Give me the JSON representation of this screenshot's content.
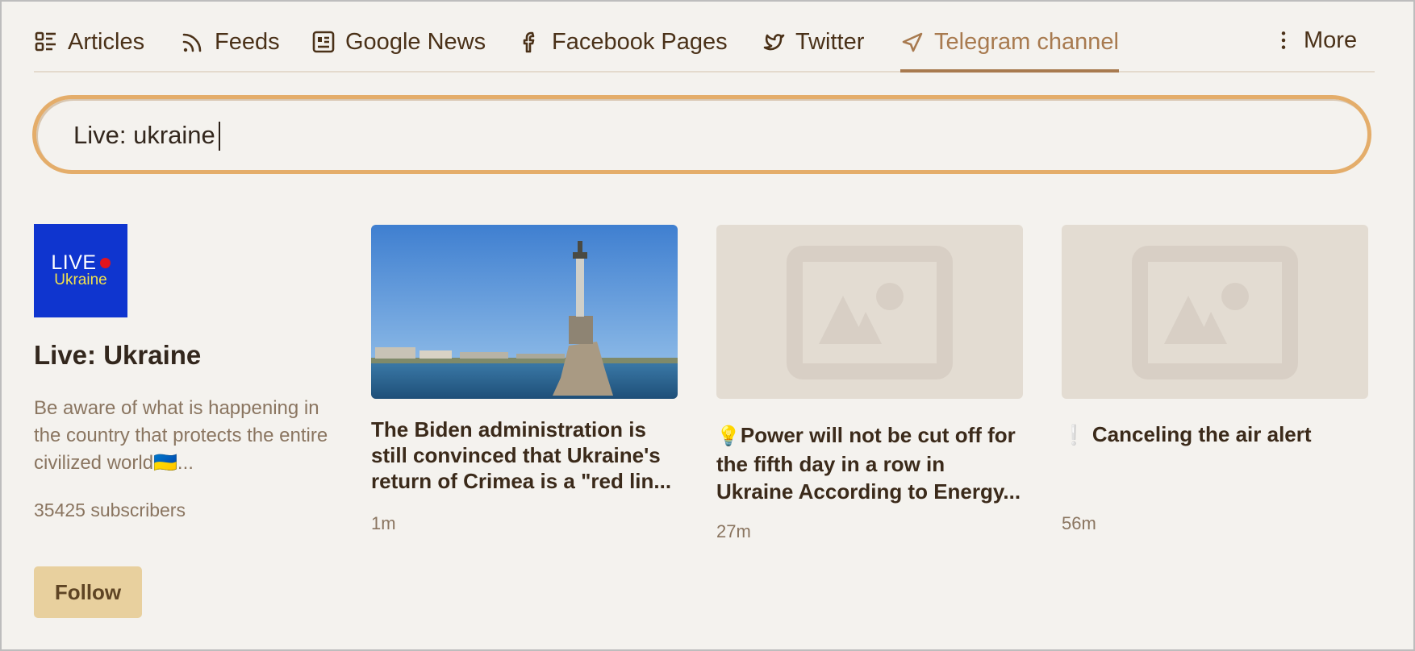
{
  "nav": {
    "tabs": [
      {
        "label": "Articles",
        "icon": "articles-list-icon",
        "active": false
      },
      {
        "label": "Feeds",
        "icon": "rss-icon",
        "active": false
      },
      {
        "label": "Google News",
        "icon": "newspaper-icon",
        "active": false
      },
      {
        "label": "Facebook Pages",
        "icon": "facebook-icon",
        "active": false
      },
      {
        "label": "Twitter",
        "icon": "twitter-icon",
        "active": false
      },
      {
        "label": "Telegram channel",
        "icon": "telegram-icon",
        "active": true
      }
    ],
    "more_label": "More",
    "accent_color": "#a87a4f"
  },
  "search": {
    "value": "Live: ukraine"
  },
  "channel": {
    "logo_line1": "LIVE",
    "logo_line2": "Ukraine",
    "title": "Live: Ukraine",
    "description": "Be aware of what is happening in the country that protects the entire civilized world🇺🇦...",
    "subscribers": "35425 subscribers",
    "follow_label": "Follow"
  },
  "posts": [
    {
      "emoji": "",
      "title": "The Biden administration is still convinced that Ukraine's return of Crimea is a \"red lin...",
      "time": "1m",
      "has_image": true
    },
    {
      "emoji": "💡",
      "title": "Power will not be cut off for the fifth day in a row in Ukraine According to Energy...",
      "time": "27m",
      "has_image": false
    },
    {
      "emoji": "❕",
      "title": "Canceling the air alert",
      "time": "56m",
      "has_image": false
    }
  ]
}
